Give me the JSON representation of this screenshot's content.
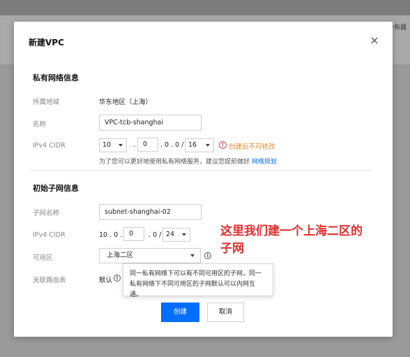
{
  "background": {
    "corner_text": "分布器"
  },
  "dialog": {
    "title": "新建VPC",
    "close_icon": "close-icon"
  },
  "vpc_section": {
    "title": "私有网络信息",
    "region_label": "所属地域",
    "region_value": "华东地区（上海）",
    "name_label": "名称",
    "name_value": "VPC-tcb-shanghai",
    "cidr_label": "IPv4 CIDR",
    "cidr_octet1": "10",
    "cidr_octet2": "0",
    "cidr_dot1": ".",
    "cidr_suffix": ". 0 . 0 /",
    "cidr_mask": "16",
    "warning_text": "创建后不可修改",
    "hint_text": "为了您可以更好地使用私有网络服务，建议您提前做好",
    "hint_link": "网络规划"
  },
  "subnet_section": {
    "title": "初始子网信息",
    "name_label": "子网名称",
    "name_value": "subnet-shanghai-02",
    "cidr_label": "IPv4 CIDR",
    "cidr_prefix": "10 . 0 .",
    "cidr_octet3": "0",
    "cidr_mid": ". 0 /",
    "cidr_mask": "24",
    "zone_label": "可用区",
    "zone_value": "上海二区",
    "route_label": "关联路由表",
    "route_value": "默认"
  },
  "tooltip": {
    "text": "同一私有网络下可以有不同可用区的子网，同一私有网络下不同可用区的子网默认可以内网互通。"
  },
  "buttons": {
    "create": "创建",
    "cancel": "取消"
  },
  "annotation": {
    "line1": "这里我们建一个上海二区的",
    "line2": "子网"
  },
  "colors": {
    "primary": "#006eff",
    "warning": "#e8882f",
    "error": "#e54545",
    "annotation": "#e23030"
  }
}
